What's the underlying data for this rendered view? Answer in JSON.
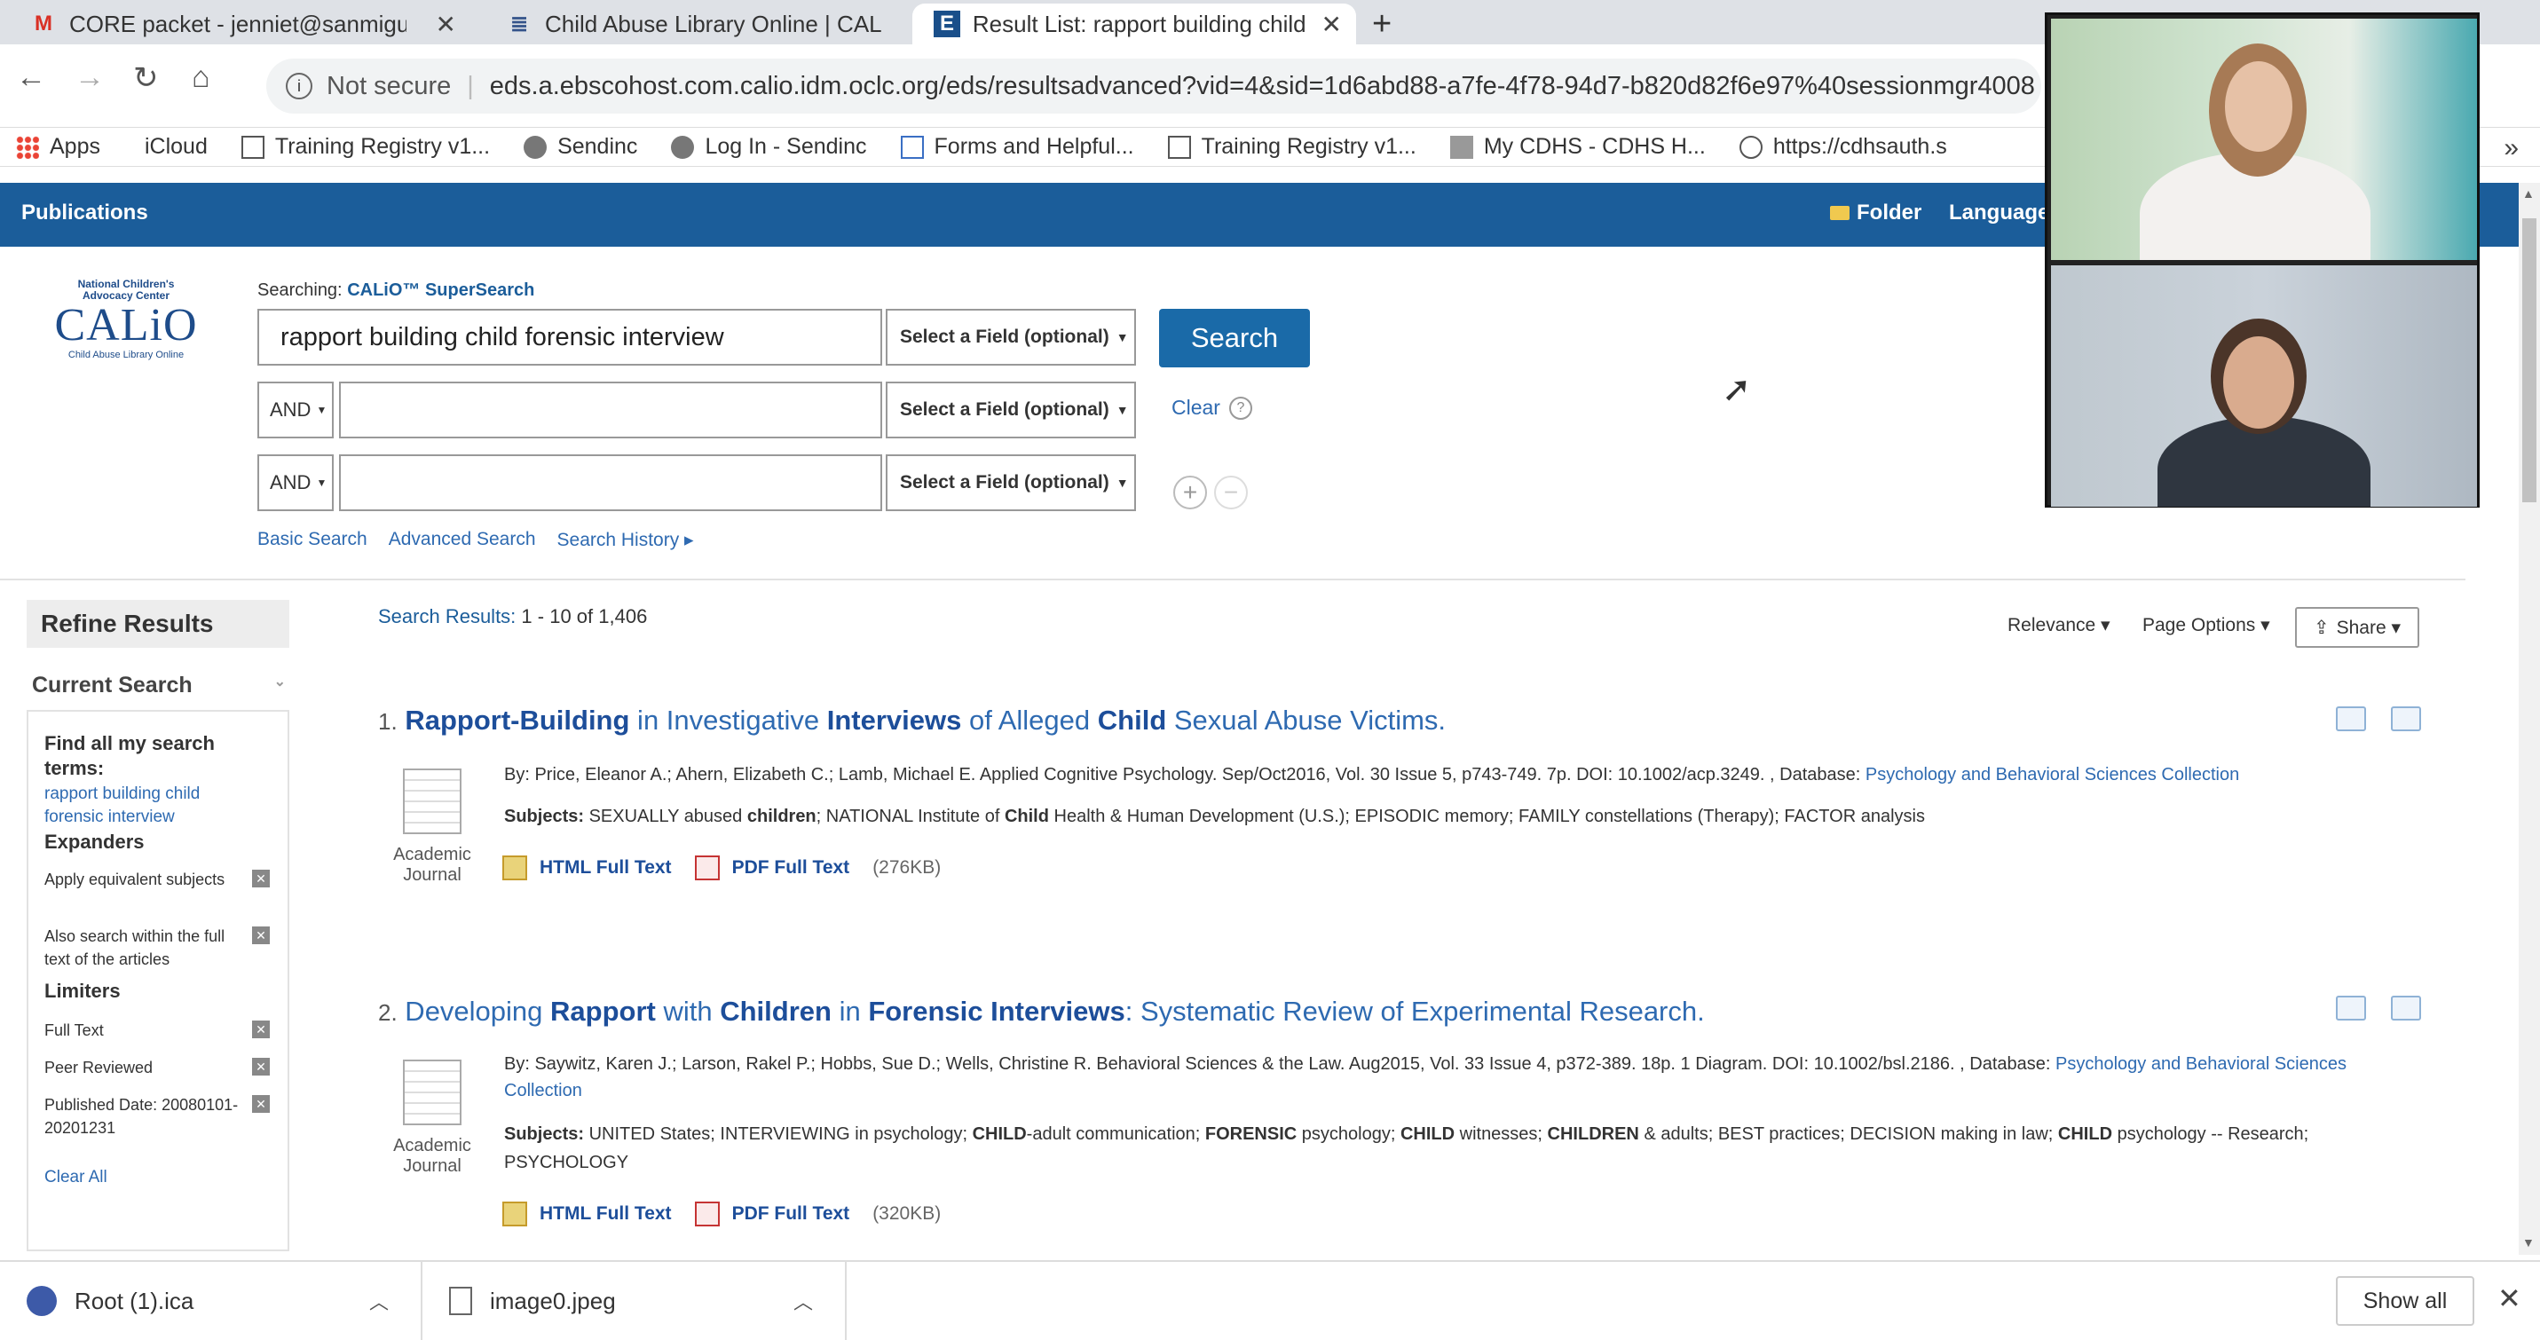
{
  "browser": {
    "tabs": [
      {
        "label": "CORE packet - jenniet@sanmigu",
        "favicon": "M",
        "favcolor": "#d93025"
      },
      {
        "label": "Child Abuse Library Online | CAL",
        "favicon": "≣",
        "favcolor": "#34538a"
      },
      {
        "label": "Result List: rapport building child",
        "favicon": "E",
        "favcolor": "#1a4f8a"
      }
    ],
    "new_tab": "+",
    "address": {
      "security_label": "Not secure",
      "url": "eds.a.ebscohost.com.calio.idm.oclc.org/eds/resultsadvanced?vid=4&sid=1d6abd88-a7fe-4f78-94d7-b820d82f6e97%40sessionmgr4008"
    },
    "bookmarks": [
      "Apps",
      "iCloud",
      "Training Registry v1...",
      "Sendinc",
      "Log In - Sendinc",
      "Forms and Helpful...",
      "Training Registry v1...",
      "My CDHS - CDHS H...",
      "https://cdhsauth.s"
    ]
  },
  "ebsco": {
    "publications": "Publications",
    "folder": "Folder",
    "language": "Language",
    "logo": {
      "line1": "National Children's",
      "line2": "Advocacy Center",
      "name": "CALiO",
      "sub": "Child Abuse Library Online"
    },
    "searching_prefix": "Searching:",
    "searching_db": "CALiO™ SuperSearch",
    "query": "rapport building child forensic interview",
    "field_select": "Select a Field (optional)",
    "and_label": "AND",
    "search_button": "Search",
    "clear": "Clear",
    "help": "?",
    "plus": "+",
    "minus": "−",
    "links": {
      "basic": "Basic Search",
      "advanced": "Advanced Search",
      "history": "Search History ▸"
    }
  },
  "sidebar": {
    "refine": "Refine Results",
    "current_search": "Current Search",
    "find_all": "Find all my search terms:",
    "find_all_value": "rapport building child forensic interview",
    "expanders": "Expanders",
    "exp1": "Apply equivalent subjects",
    "exp2": "Also search within the full text of the articles",
    "limiters": "Limiters",
    "lim1": "Full Text",
    "lim2": "Peer Reviewed",
    "lim3": "Published Date: 20080101-20201231",
    "clear_all": "Clear All"
  },
  "results": {
    "count_label": "Search Results:",
    "count_value": "1 - 10 of 1,406",
    "relevance": "Relevance ▾",
    "page_options": "Page Options ▾",
    "share": "Share ▾",
    "doc_type": "Academic Journal",
    "html_ft": "HTML Full Text",
    "pdf_ft": "PDF Full Text",
    "r1": {
      "num": "1.",
      "meta": "By: Price, Eleanor A.; Ahern, Elizabeth C.; Lamb, Michael E. Applied Cognitive Psychology. Sep/Oct2016, Vol. 30 Issue 5, p743-749. 7p. DOI: 10.1002/acp.3249. , Database:",
      "db": "Psychology and Behavioral Sciences Collection",
      "subjects_label": "Subjects:",
      "size": "(276KB)"
    },
    "r2": {
      "num": "2.",
      "meta": "By: Saywitz, Karen J.; Larson, Rakel P.; Hobbs, Sue D.; Wells, Christine R. Behavioral Sciences & the Law. Aug2015, Vol. 33 Issue 4, p372-389. 18p. 1 Diagram. DOI: 10.1002/bsl.2186. , Database:",
      "db": "Psychology and Behavioral Sciences Collection",
      "subjects_label": "Subjects:",
      "size": "(320KB)"
    }
  },
  "downloads": {
    "item1": "Root (1).ica",
    "item2": "image0.jpeg",
    "show_all": "Show all"
  }
}
